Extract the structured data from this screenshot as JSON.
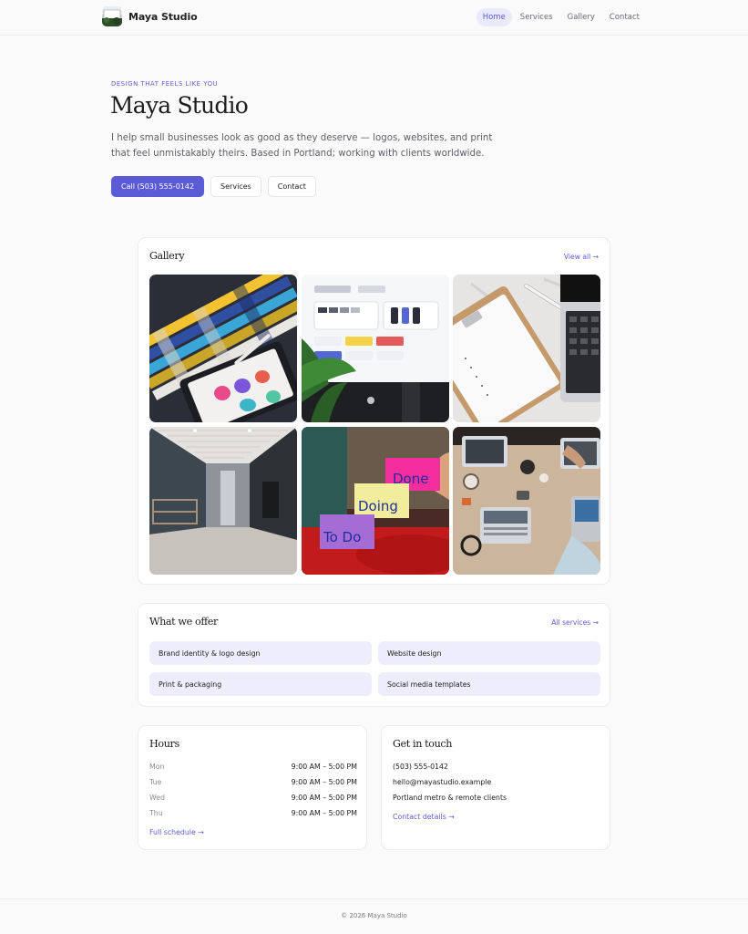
{
  "header": {
    "brand_name": "Maya Studio",
    "nav": [
      {
        "label": "Home",
        "active": true
      },
      {
        "label": "Services",
        "active": false
      },
      {
        "label": "Gallery",
        "active": false
      },
      {
        "label": "Contact",
        "active": false
      }
    ]
  },
  "hero": {
    "eyebrow": "DESIGN THAT FEELS LIKE YOU",
    "title": "Maya Studio",
    "description": "I help small businesses look as good as they deserve — logos, websites, and print that feel unmistakably theirs. Based in Portland; working with clients worldwide.",
    "buttons": {
      "call": "Call (503) 555-0142",
      "services": "Services",
      "contact": "Contact"
    }
  },
  "gallery": {
    "title": "Gallery",
    "link": "View all →",
    "tiles": [
      "color-swatches-photo",
      "design-ui-monitor-photo",
      "clipboard-desk-photo",
      "office-hallway-photo",
      "sticky-notes-photo",
      "team-laptops-photo"
    ],
    "sticky_notes": [
      "Done",
      "Doing",
      "To Do"
    ]
  },
  "offer": {
    "title": "What we offer",
    "link": "All services →",
    "items": [
      "Brand identity & logo design",
      "Website design",
      "Print & packaging",
      "Social media templates"
    ]
  },
  "hours": {
    "title": "Hours",
    "rows": [
      {
        "day": "Mon",
        "time": "9:00 AM – 5:00 PM"
      },
      {
        "day": "Tue",
        "time": "9:00 AM – 5:00 PM"
      },
      {
        "day": "Wed",
        "time": "9:00 AM – 5:00 PM"
      },
      {
        "day": "Thu",
        "time": "9:00 AM – 5:00 PM"
      }
    ],
    "link": "Full schedule →"
  },
  "contact": {
    "title": "Get in touch",
    "phone": "(503) 555-0142",
    "email": "hello@mayastudio.example",
    "area": "Portland metro & remote clients",
    "link": "Contact details →"
  },
  "footer": {
    "text": "© 2026 Maya Studio"
  },
  "colors": {
    "accent": "#5b5bd6",
    "chip_bg": "#eeedfb",
    "page_bg": "#fafafa"
  }
}
